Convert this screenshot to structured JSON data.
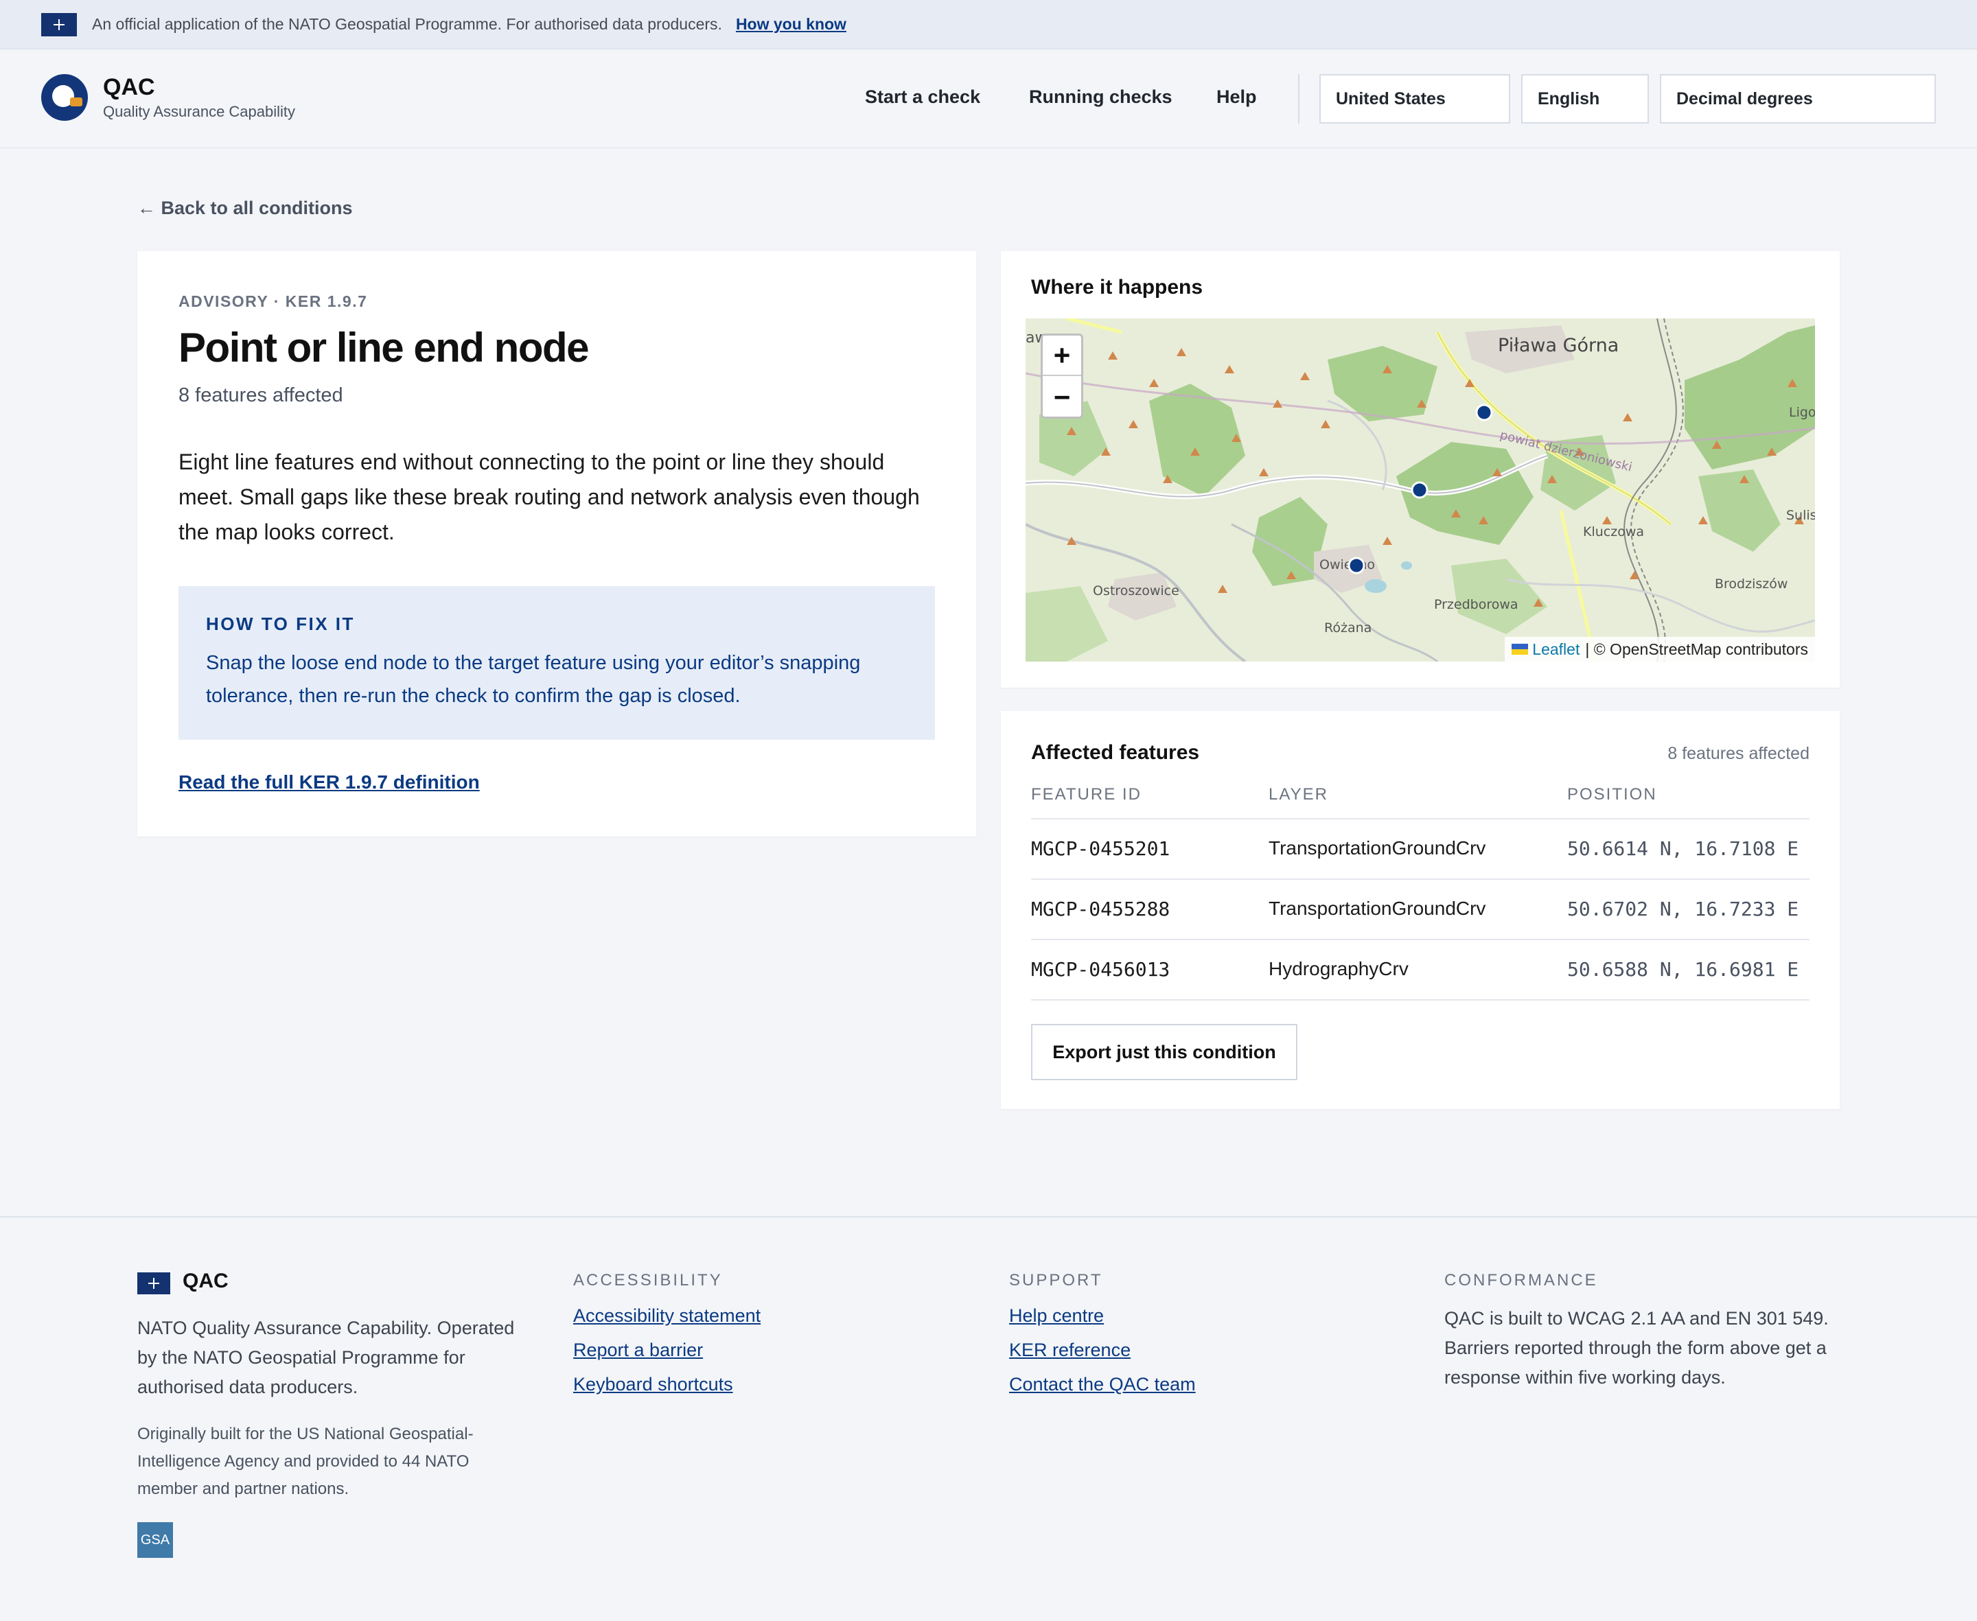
{
  "banner": {
    "text": "An official application of the NATO Geospatial Programme. For authorised data producers.",
    "link": "How you know"
  },
  "header": {
    "brand_title": "QAC",
    "brand_subtitle": "Quality Assurance Capability",
    "nav": [
      "Start a check",
      "Running checks",
      "Help"
    ],
    "country_select": "United States",
    "language_select": "English",
    "coordinate_select": "Decimal degrees"
  },
  "back_link": "← Back to all conditions",
  "condition": {
    "eyebrow": "ADVISORY · KER 1.9.7",
    "title": "Point or line end node",
    "affected": "8 features affected",
    "description": "Eight line features end without connecting to the point or line they should meet. Small gaps like these break routing and network analysis even though the map looks correct.",
    "fix_heading": "HOW TO FIX IT",
    "fix_text": "Snap the loose end node to the target feature using your editor’s snapping tolerance, then re-run the check to confirm the gap is closed.",
    "definition_link": "Read the full KER 1.9.7 definition"
  },
  "map": {
    "title": "Where it happens",
    "zoom_in": "+",
    "zoom_out": "−",
    "place_labels": [
      "Piława Górna",
      "powiat dzierżoniowski",
      "Kluczowa",
      "Ostroszowice",
      "Owiesno",
      "Przedborowa",
      "Różana",
      "Brodziszów",
      "Ligota",
      "Sulist",
      "aw"
    ],
    "attribution_leaflet": "Leaflet",
    "attribution_osm": "| © OpenStreetMap contributors"
  },
  "features": {
    "title": "Affected features",
    "count": "8 features affected",
    "columns": [
      "FEATURE ID",
      "LAYER",
      "POSITION"
    ],
    "rows": [
      {
        "id": "MGCP-0455201",
        "layer": "TransportationGroundCrv",
        "position": "50.6614 N, 16.7108 E"
      },
      {
        "id": "MGCP-0455288",
        "layer": "TransportationGroundCrv",
        "position": "50.6702 N, 16.7233 E"
      },
      {
        "id": "MGCP-0456013",
        "layer": "HydrographyCrv",
        "position": "50.6588 N, 16.6981 E"
      }
    ],
    "export_button": "Export just this condition"
  },
  "footer": {
    "brand": "QAC",
    "about": "NATO Quality Assurance Capability. Operated by the NATO Geospatial Programme for authorised data producers.",
    "origin": "Originally built for the US National Geospatial-Intelligence Agency and provided to 44 NATO member and partner nations.",
    "badge": "GSA",
    "accessibility_heading": "ACCESSIBILITY",
    "accessibility_links": [
      "Accessibility statement",
      "Report a barrier",
      "Keyboard shortcuts"
    ],
    "support_heading": "SUPPORT",
    "support_links": [
      "Help centre",
      "KER reference",
      "Contact the QAC team"
    ],
    "conformance_heading": "CONFORMANCE",
    "conformance_text": "QAC is built to WCAG 2.1 AA and EN 301 549. Barriers reported through the form above get a response within five working days."
  },
  "colors": {
    "accent": "#0b3a82",
    "brand_navy": "#13357a",
    "fix_box_bg": "#e6edf8",
    "page_bg": "#f3f5f9",
    "marker": "#0b3a82"
  }
}
